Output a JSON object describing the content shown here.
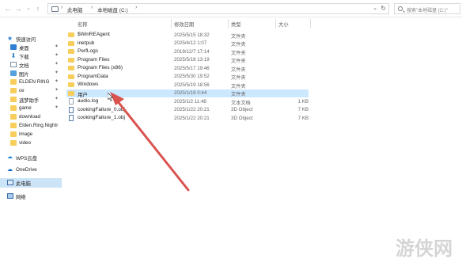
{
  "address": {
    "crumbs": [
      "此电脑",
      "本地磁盘 (C:)"
    ],
    "search_placeholder": "搜索\"本地磁盘 (C:)\""
  },
  "nav": {
    "items": [
      {
        "label": "快速访问",
        "icon": "star-icon"
      },
      {
        "label": "桌面",
        "icon": "desktop-icon",
        "pinned": true
      },
      {
        "label": "下载",
        "icon": "download-icon",
        "pinned": true
      },
      {
        "label": "文档",
        "icon": "documents-icon",
        "pinned": true
      },
      {
        "label": "图片",
        "icon": "pictures-icon",
        "pinned": true
      },
      {
        "label": "ELDEN RING",
        "icon": "folder-icon",
        "pinned": true
      },
      {
        "label": "ce",
        "icon": "folder-icon",
        "pinned": true
      },
      {
        "label": "逃梦助手",
        "icon": "folder-icon",
        "pinned": true
      },
      {
        "label": "game",
        "icon": "folder-icon",
        "pinned": true
      },
      {
        "label": "download",
        "icon": "folder-icon"
      },
      {
        "label": "Elden.Ring.Nightr",
        "icon": "folder-icon"
      },
      {
        "label": "image",
        "icon": "folder-icon"
      },
      {
        "label": "video",
        "icon": "folder-icon"
      },
      {
        "label": "WPS云盘",
        "icon": "cloud-icon"
      },
      {
        "label": "OneDrive",
        "icon": "onedrive-icon"
      },
      {
        "label": "此电脑",
        "icon": "this-pc-icon",
        "selected": true
      },
      {
        "label": "网络",
        "icon": "network-icon"
      }
    ]
  },
  "columns": {
    "name": "名称",
    "date": "修改日期",
    "type": "类型",
    "size": "大小"
  },
  "files": [
    {
      "name": "$WinREAgent",
      "date": "2025/5/15 18:32",
      "type": "文件夹",
      "size": "",
      "icon": "folder"
    },
    {
      "name": "inetpub",
      "date": "2025/4/12 1:07",
      "type": "文件夹",
      "size": "",
      "icon": "folder"
    },
    {
      "name": "PerfLogs",
      "date": "2019/12/7 17:14",
      "type": "文件夹",
      "size": "",
      "icon": "folder"
    },
    {
      "name": "Program Files",
      "date": "2025/5/18 13:19",
      "type": "文件夹",
      "size": "",
      "icon": "folder"
    },
    {
      "name": "Program Files (x86)",
      "date": "2025/5/17 19:46",
      "type": "文件夹",
      "size": "",
      "icon": "folder"
    },
    {
      "name": "ProgramData",
      "date": "2025/5/30 19:52",
      "type": "文件夹",
      "size": "",
      "icon": "folder"
    },
    {
      "name": "Windows",
      "date": "2025/5/19 18:56",
      "type": "文件夹",
      "size": "",
      "icon": "folder"
    },
    {
      "name": "用户",
      "date": "2025/1/18 0:44",
      "type": "文件夹",
      "size": "",
      "icon": "folder",
      "selected": true
    },
    {
      "name": "audio.log",
      "date": "2025/1/2 11:48",
      "type": "文本文档",
      "size": "1 KB",
      "icon": "file"
    },
    {
      "name": "cookingFailure_0.obj",
      "date": "2025/1/22 20:21",
      "type": "3D Object",
      "size": "7 KB",
      "icon": "obj"
    },
    {
      "name": "cookingFailure_1.obj",
      "date": "2025/1/22 20:21",
      "type": "3D Object",
      "size": "7 KB",
      "icon": "obj"
    }
  ],
  "watermark": "游侠网",
  "colors": {
    "selection": "#cce8ff",
    "nav_selection": "#cce4f7",
    "folder": "#f7ce5b",
    "arrow": "#d9534f"
  }
}
